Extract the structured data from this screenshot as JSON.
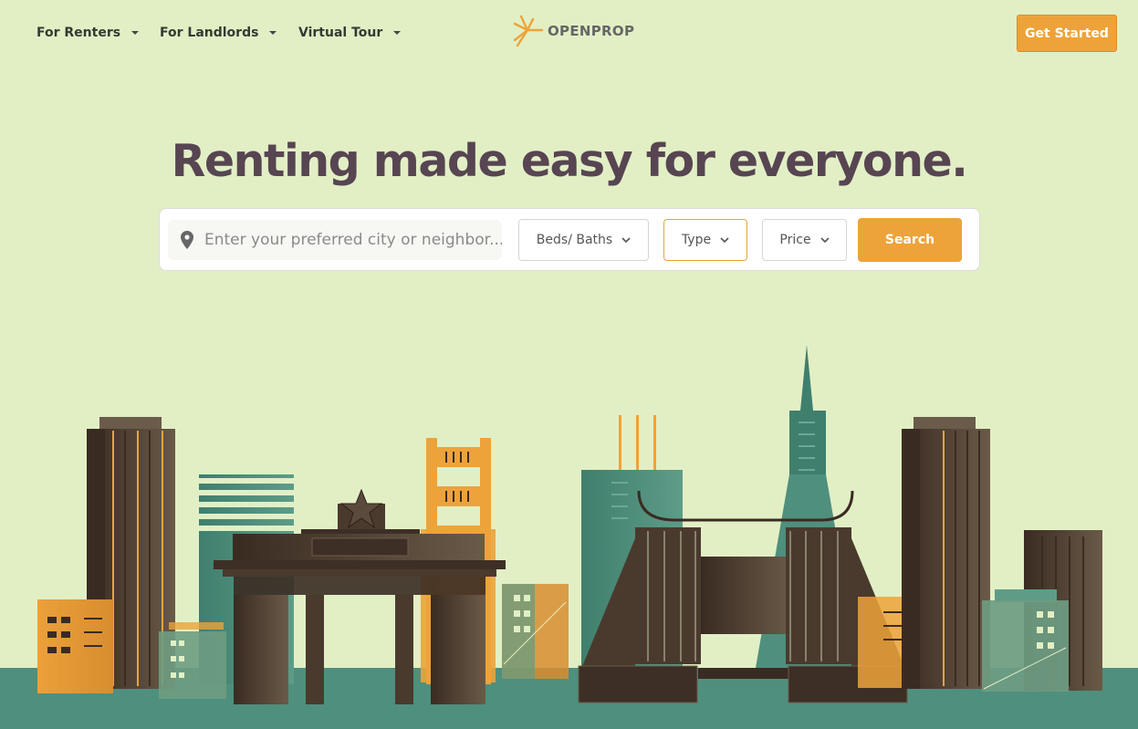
{
  "nav": {
    "items": [
      {
        "label": "For Renters"
      },
      {
        "label": "For Landlords"
      },
      {
        "label": "Virtual Tour"
      }
    ],
    "logo_text": "OPENPROP",
    "cta_label": "Get Started"
  },
  "hero": {
    "title": "Renting made easy for everyone."
  },
  "search": {
    "placeholder": "Enter your preferred city or neighbor...",
    "beds_baths_label": "Beds/ Baths",
    "type_label": "Type",
    "price_label": "Price",
    "button_label": "Search"
  },
  "colors": {
    "background": "#e2efc5",
    "accent": "#eda33a",
    "title": "#574552",
    "teal": "#4f8f7d",
    "dark_brown": "#3d2f25"
  }
}
